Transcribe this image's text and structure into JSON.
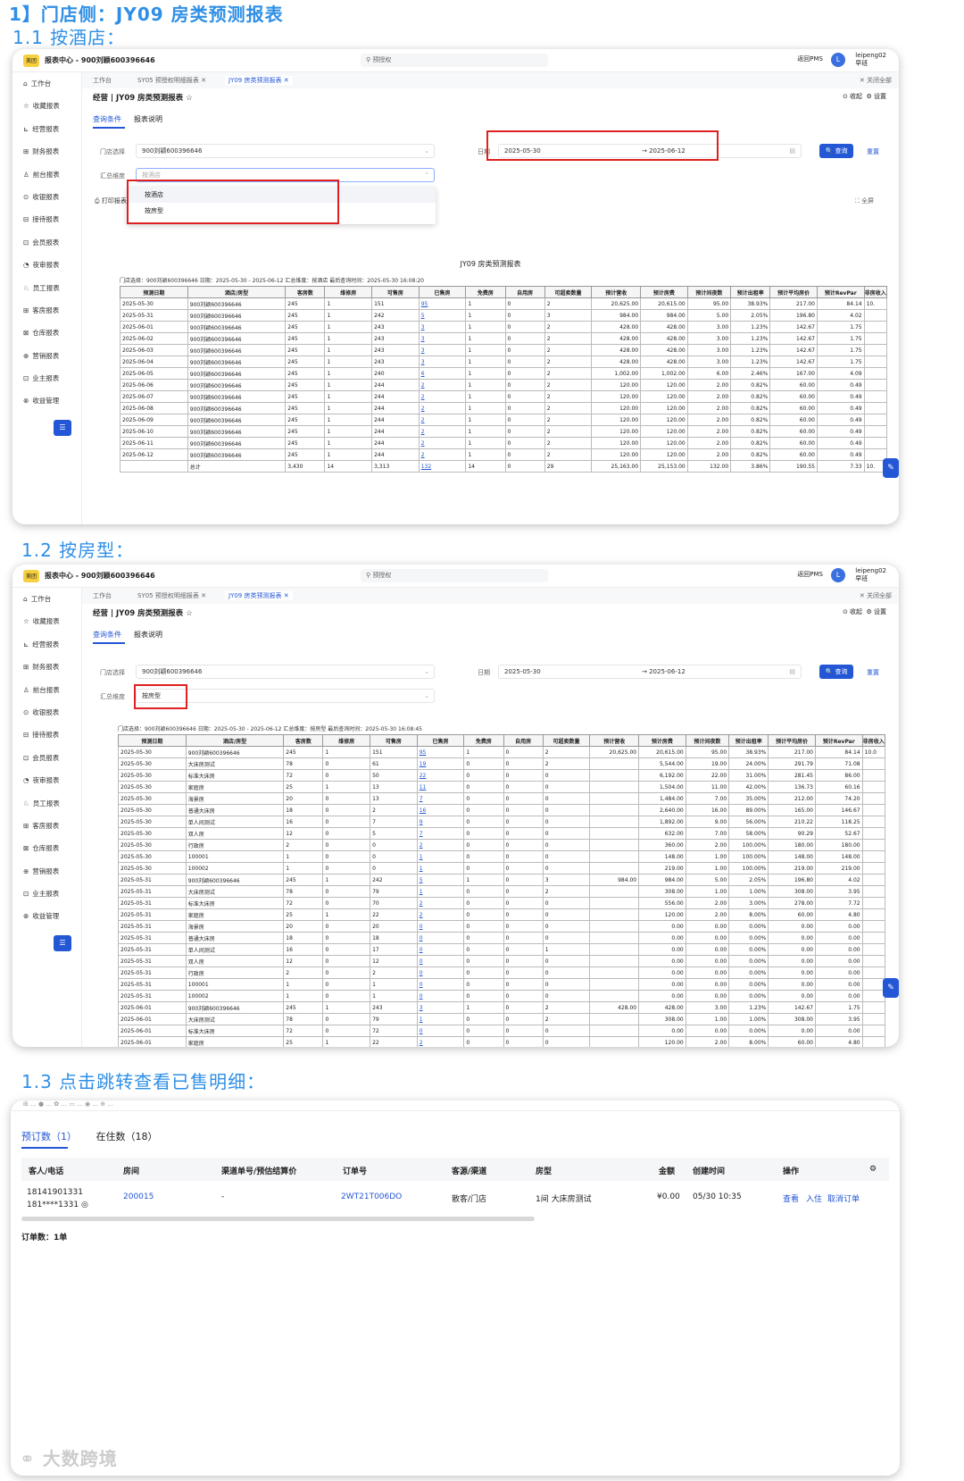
{
  "headings": {
    "main": "1】门店侧：JY09 房类预测报表",
    "s1": "1.1  按酒店：",
    "s2": "1.2  按房型：",
    "s3": "1.3  点击跳转查看已售明细："
  },
  "app": {
    "logo": "美团",
    "title": "报表中心 - 900刘颖600396646",
    "search_placeholder": "预授权",
    "back_pms": "返回PMS",
    "avatar_letter": "L",
    "user_name": "leipeng02",
    "user_shift": "早班",
    "close_all": "✕ 关闭全部"
  },
  "sidebar": [
    "工作台",
    "收藏报表",
    "经营报表",
    "财务报表",
    "前台报表",
    "收银报表",
    "接待报表",
    "会员报表",
    "夜审报表",
    "员工报表",
    "客房报表",
    "仓库报表",
    "营销报表",
    "业主报表",
    "收益管理"
  ],
  "sidebar_icons": [
    "⌂",
    "☆",
    "⊾",
    "⊞",
    "♙",
    "⊙",
    "⊟",
    "⊡",
    "◔",
    "♘",
    "⊞",
    "⊠",
    "⊕",
    "⊡",
    "⊗"
  ],
  "tabs": [
    "工作台",
    "SY05 预授权明细报表",
    "JY09 房类预测报表"
  ],
  "page": {
    "crumb": "经营 | JY09 房类预测报表 ☆",
    "collapse": "⊙ 收起",
    "settings": "⚙ 设置",
    "tab_query": "查询条件",
    "tab_desc": "报表说明",
    "store_label": "门店选择",
    "store_value": "900刘颖600396646",
    "date_label": "日期",
    "date_start": "2025-05-30",
    "date_end": "2025-06-12",
    "dim_label": "汇总维度",
    "query_btn": "🔍 查询",
    "reset_btn": "重置",
    "print": "打印报表",
    "fullscreen": "⛶ 全屏"
  },
  "s1": {
    "dim_value": "按酒店",
    "dropdown": [
      "按酒店",
      "按房型"
    ],
    "report_title": "JY09 房类预测报表",
    "meta": "门店选择：900刘颖600396646  日期：2025-05-30 - 2025-06-12  汇总维度：按酒店  最后查询时间：2025-05-30 16:08:20"
  },
  "s2": {
    "dim_value": "按房型",
    "meta": "门店选择：900刘颖600396646  日期：2025-05-30 - 2025-06-12  汇总维度：按房型  最后查询时间：2025-05-30 16:08:45"
  },
  "columns": [
    "预测日期",
    "酒店/房型",
    "客房数",
    "维修房",
    "可售房",
    "已售房",
    "免费房",
    "自用房",
    "可超卖数量",
    "预计营收",
    "预计房费",
    "预计间夜数",
    "预计出租率",
    "预计平均房价",
    "预计RevPar",
    "非房收入"
  ],
  "s1_rows": [
    [
      "2025-05-30",
      "900刘颖600396646",
      "245",
      "1",
      "151",
      "95",
      "1",
      "0",
      "2",
      "20,625.00",
      "20,615.00",
      "95.00",
      "38.93%",
      "217.00",
      "84.14",
      "10."
    ],
    [
      "2025-05-31",
      "900刘颖600396646",
      "245",
      "1",
      "242",
      "5",
      "1",
      "0",
      "3",
      "984.00",
      "984.00",
      "5.00",
      "2.05%",
      "196.80",
      "4.02",
      ""
    ],
    [
      "2025-06-01",
      "900刘颖600396646",
      "245",
      "1",
      "243",
      "3",
      "1",
      "0",
      "2",
      "428.00",
      "428.00",
      "3.00",
      "1.23%",
      "142.67",
      "1.75",
      ""
    ],
    [
      "2025-06-02",
      "900刘颖600396646",
      "245",
      "1",
      "243",
      "3",
      "1",
      "0",
      "2",
      "428.00",
      "428.00",
      "3.00",
      "1.23%",
      "142.67",
      "1.75",
      ""
    ],
    [
      "2025-06-03",
      "900刘颖600396646",
      "245",
      "1",
      "243",
      "3",
      "1",
      "0",
      "2",
      "428.00",
      "428.00",
      "3.00",
      "1.23%",
      "142.67",
      "1.75",
      ""
    ],
    [
      "2025-06-04",
      "900刘颖600396646",
      "245",
      "1",
      "243",
      "3",
      "1",
      "0",
      "2",
      "428.00",
      "428.00",
      "3.00",
      "1.23%",
      "142.67",
      "1.75",
      ""
    ],
    [
      "2025-06-05",
      "900刘颖600396646",
      "245",
      "1",
      "240",
      "6",
      "1",
      "0",
      "2",
      "1,002.00",
      "1,002.00",
      "6.00",
      "2.46%",
      "167.00",
      "4.09",
      ""
    ],
    [
      "2025-06-06",
      "900刘颖600396646",
      "245",
      "1",
      "244",
      "2",
      "1",
      "0",
      "2",
      "120.00",
      "120.00",
      "2.00",
      "0.82%",
      "60.00",
      "0.49",
      ""
    ],
    [
      "2025-06-07",
      "900刘颖600396646",
      "245",
      "1",
      "244",
      "2",
      "1",
      "0",
      "2",
      "120.00",
      "120.00",
      "2.00",
      "0.82%",
      "60.00",
      "0.49",
      ""
    ],
    [
      "2025-06-08",
      "900刘颖600396646",
      "245",
      "1",
      "244",
      "2",
      "1",
      "0",
      "2",
      "120.00",
      "120.00",
      "2.00",
      "0.82%",
      "60.00",
      "0.49",
      ""
    ],
    [
      "2025-06-09",
      "900刘颖600396646",
      "245",
      "1",
      "244",
      "2",
      "1",
      "0",
      "2",
      "120.00",
      "120.00",
      "2.00",
      "0.82%",
      "60.00",
      "0.49",
      ""
    ],
    [
      "2025-06-10",
      "900刘颖600396646",
      "245",
      "1",
      "244",
      "2",
      "1",
      "0",
      "2",
      "120.00",
      "120.00",
      "2.00",
      "0.82%",
      "60.00",
      "0.49",
      ""
    ],
    [
      "2025-06-11",
      "900刘颖600396646",
      "245",
      "1",
      "244",
      "2",
      "1",
      "0",
      "2",
      "120.00",
      "120.00",
      "2.00",
      "0.82%",
      "60.00",
      "0.49",
      ""
    ],
    [
      "2025-06-12",
      "900刘颖600396646",
      "245",
      "1",
      "244",
      "2",
      "1",
      "0",
      "2",
      "120.00",
      "120.00",
      "2.00",
      "0.82%",
      "60.00",
      "0.49",
      ""
    ],
    [
      "",
      "总计",
      "3,430",
      "14",
      "3,313",
      "132",
      "14",
      "0",
      "29",
      "25,163.00",
      "25,153.00",
      "132.00",
      "3.86%",
      "190.55",
      "7.33",
      "10."
    ]
  ],
  "s2_rows": [
    [
      "2025-05-30",
      "900刘颖600396646",
      "245",
      "1",
      "151",
      "95",
      "1",
      "0",
      "2",
      "20,625.00",
      "20,615.00",
      "95.00",
      "38.93%",
      "217.00",
      "84.14",
      "10.0"
    ],
    [
      "2025-05-30",
      "大床房测试",
      "78",
      "0",
      "61",
      "19",
      "0",
      "0",
      "2",
      "",
      "5,544.00",
      "19.00",
      "24.00%",
      "291.79",
      "71.08",
      ""
    ],
    [
      "2025-05-30",
      "标准大床房",
      "72",
      "0",
      "50",
      "22",
      "0",
      "0",
      "0",
      "",
      "6,192.00",
      "22.00",
      "31.00%",
      "281.45",
      "86.00",
      ""
    ],
    [
      "2025-05-30",
      "家庭房",
      "25",
      "1",
      "13",
      "11",
      "0",
      "0",
      "0",
      "",
      "1,504.00",
      "11.00",
      "42.00%",
      "136.73",
      "60.16",
      ""
    ],
    [
      "2025-05-30",
      "海景房",
      "20",
      "0",
      "13",
      "7",
      "0",
      "0",
      "0",
      "",
      "1,484.00",
      "7.00",
      "35.00%",
      "212.00",
      "74.20",
      ""
    ],
    [
      "2025-05-30",
      "普通大床房",
      "18",
      "0",
      "2",
      "16",
      "0",
      "0",
      "0",
      "",
      "2,640.00",
      "16.00",
      "89.00%",
      "165.00",
      "146.67",
      ""
    ],
    [
      "2025-05-30",
      "单人间测试",
      "16",
      "0",
      "7",
      "9",
      "0",
      "0",
      "0",
      "",
      "1,892.00",
      "9.00",
      "56.00%",
      "210.22",
      "118.25",
      ""
    ],
    [
      "2025-05-30",
      "双人房",
      "12",
      "0",
      "5",
      "7",
      "0",
      "0",
      "0",
      "",
      "632.00",
      "7.00",
      "58.00%",
      "90.29",
      "52.67",
      ""
    ],
    [
      "2025-05-30",
      "行政房",
      "2",
      "0",
      "0",
      "2",
      "0",
      "0",
      "0",
      "",
      "360.00",
      "2.00",
      "100.00%",
      "180.00",
      "180.00",
      ""
    ],
    [
      "2025-05-30",
      "100001",
      "1",
      "0",
      "0",
      "1",
      "0",
      "0",
      "0",
      "",
      "148.00",
      "1.00",
      "100.00%",
      "148.00",
      "148.00",
      ""
    ],
    [
      "2025-05-30",
      "100002",
      "1",
      "0",
      "0",
      "1",
      "0",
      "0",
      "0",
      "",
      "219.00",
      "1.00",
      "100.00%",
      "219.00",
      "219.00",
      ""
    ],
    [
      "2025-05-31",
      "900刘颖600396646",
      "245",
      "1",
      "242",
      "5",
      "1",
      "0",
      "3",
      "984.00",
      "984.00",
      "5.00",
      "2.05%",
      "196.80",
      "4.02",
      ""
    ],
    [
      "2025-05-31",
      "大床房测试",
      "78",
      "0",
      "79",
      "1",
      "0",
      "0",
      "2",
      "",
      "308.00",
      "1.00",
      "1.00%",
      "308.00",
      "3.95",
      ""
    ],
    [
      "2025-05-31",
      "标准大床房",
      "72",
      "0",
      "70",
      "2",
      "0",
      "0",
      "0",
      "",
      "556.00",
      "2.00",
      "3.00%",
      "278.00",
      "7.72",
      ""
    ],
    [
      "2025-05-31",
      "家庭房",
      "25",
      "1",
      "22",
      "2",
      "0",
      "0",
      "0",
      "",
      "120.00",
      "2.00",
      "8.00%",
      "60.00",
      "4.80",
      ""
    ],
    [
      "2025-05-31",
      "海景房",
      "20",
      "0",
      "20",
      "0",
      "0",
      "0",
      "0",
      "",
      "0.00",
      "0.00",
      "0.00%",
      "0.00",
      "0.00",
      ""
    ],
    [
      "2025-05-31",
      "普通大床房",
      "18",
      "0",
      "18",
      "0",
      "0",
      "0",
      "0",
      "",
      "0.00",
      "0.00",
      "0.00%",
      "0.00",
      "0.00",
      ""
    ],
    [
      "2025-05-31",
      "单人间测试",
      "16",
      "0",
      "17",
      "0",
      "0",
      "0",
      "1",
      "",
      "0.00",
      "0.00",
      "0.00%",
      "0.00",
      "0.00",
      ""
    ],
    [
      "2025-05-31",
      "双人房",
      "12",
      "0",
      "12",
      "0",
      "0",
      "0",
      "0",
      "",
      "0.00",
      "0.00",
      "0.00%",
      "0.00",
      "0.00",
      ""
    ],
    [
      "2025-05-31",
      "行政房",
      "2",
      "0",
      "2",
      "0",
      "0",
      "0",
      "0",
      "",
      "0.00",
      "0.00",
      "0.00%",
      "0.00",
      "0.00",
      ""
    ],
    [
      "2025-05-31",
      "100001",
      "1",
      "0",
      "1",
      "0",
      "0",
      "0",
      "0",
      "",
      "0.00",
      "0.00",
      "0.00%",
      "0.00",
      "0.00",
      ""
    ],
    [
      "2025-05-31",
      "100002",
      "1",
      "0",
      "1",
      "0",
      "0",
      "0",
      "0",
      "",
      "0.00",
      "0.00",
      "0.00%",
      "0.00",
      "0.00",
      ""
    ],
    [
      "2025-06-01",
      "900刘颖600396646",
      "245",
      "1",
      "243",
      "3",
      "1",
      "0",
      "2",
      "428.00",
      "428.00",
      "3.00",
      "1.23%",
      "142.67",
      "1.75",
      ""
    ],
    [
      "2025-06-01",
      "大床房测试",
      "78",
      "0",
      "79",
      "1",
      "0",
      "0",
      "2",
      "",
      "308.00",
      "1.00",
      "1.00%",
      "308.00",
      "3.95",
      ""
    ],
    [
      "2025-06-01",
      "标准大床房",
      "72",
      "0",
      "72",
      "0",
      "0",
      "0",
      "0",
      "",
      "0.00",
      "0.00",
      "0.00%",
      "0.00",
      "0.00",
      ""
    ],
    [
      "2025-06-01",
      "家庭房",
      "25",
      "1",
      "22",
      "2",
      "0",
      "0",
      "0",
      "",
      "120.00",
      "2.00",
      "8.00%",
      "60.00",
      "4.80",
      ""
    ]
  ],
  "s3": {
    "tab_reserve": "预订数（1）",
    "tab_stay": "在住数（18）",
    "headers": [
      "客人/电话",
      "房间",
      "渠道单号/预估结算价",
      "订单号",
      "客源/渠道",
      "房型",
      "金额",
      "创建时间",
      "操作"
    ],
    "phone1": "18141901331",
    "phone2": "181****1331 ◎",
    "room": "200015",
    "channel_no": "-",
    "order_no": "2WT21T006DO",
    "source": "散客/门店",
    "room_type": "1间 大床房测试",
    "amount": "¥0.00",
    "created": "05/30 10:35",
    "op_view": "查看",
    "op_checkin": "入住",
    "op_cancel": "取消订单",
    "count": "订单数：1单",
    "watermark": "大数跨境"
  }
}
